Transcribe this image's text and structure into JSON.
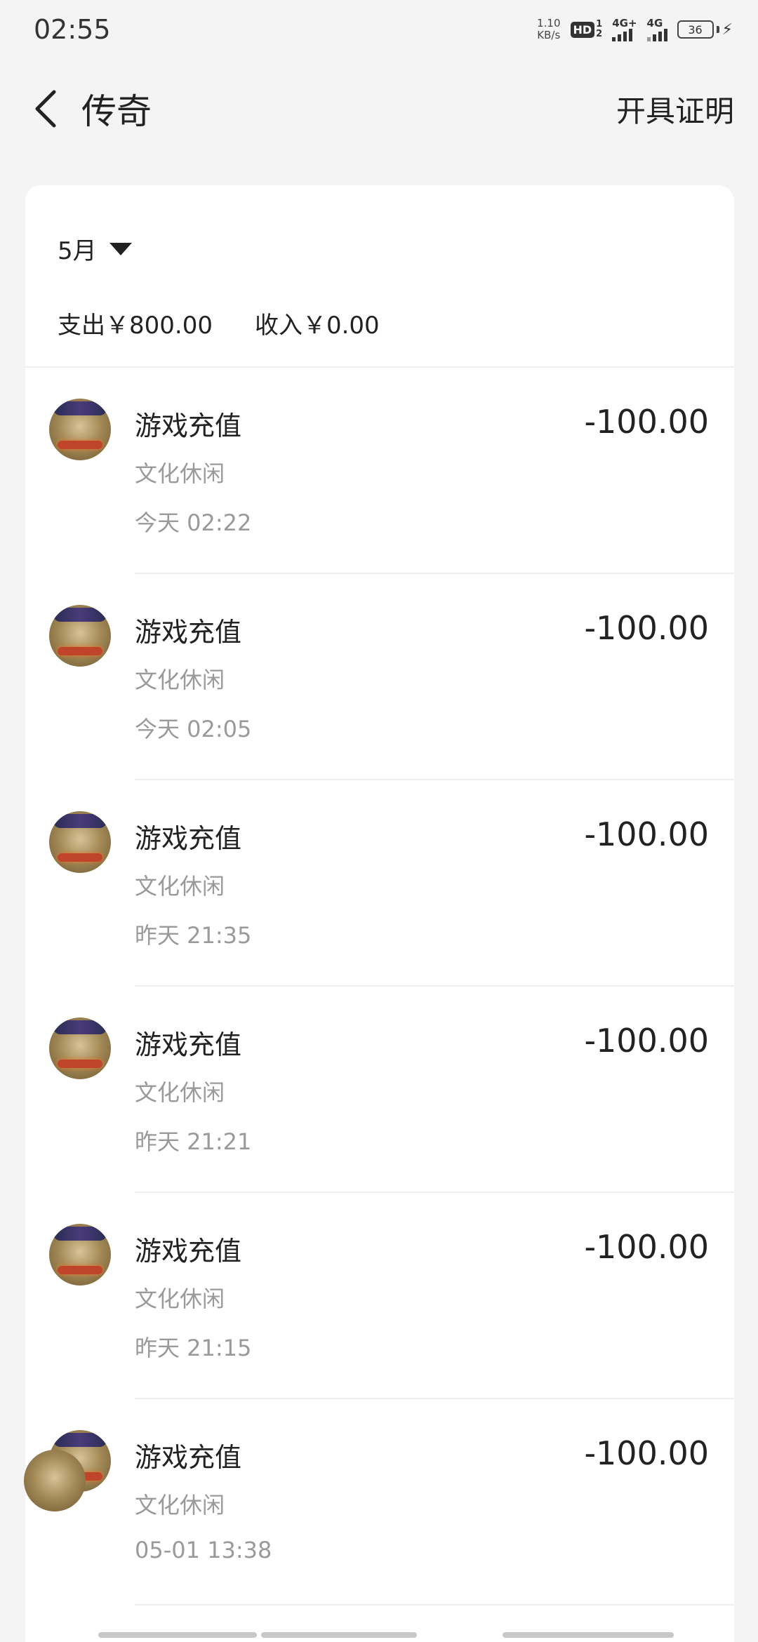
{
  "status_bar": {
    "time": "02:55",
    "net_speed_value": "1.10",
    "net_speed_unit": "KB/s",
    "hd_label": "HD",
    "hd_sub_top": "1",
    "hd_sub_bottom": "2",
    "sim1_label": "4G+",
    "sim2_label": "4G",
    "battery_level": "36"
  },
  "header": {
    "title": "传奇",
    "certificate_label": "开具证明"
  },
  "filter": {
    "month_label": "5月"
  },
  "summary": {
    "expense": "支出￥800.00",
    "income": "收入￥0.00"
  },
  "transactions": [
    {
      "title": "游戏充值",
      "category": "文化休闲",
      "time": "今天 02:22",
      "amount": "-100.00"
    },
    {
      "title": "游戏充值",
      "category": "文化休闲",
      "time": "今天 02:05",
      "amount": "-100.00"
    },
    {
      "title": "游戏充值",
      "category": "文化休闲",
      "time": "昨天 21:35",
      "amount": "-100.00"
    },
    {
      "title": "游戏充值",
      "category": "文化休闲",
      "time": "昨天 21:21",
      "amount": "-100.00"
    },
    {
      "title": "游戏充值",
      "category": "文化休闲",
      "time": "昨天 21:15",
      "amount": "-100.00"
    },
    {
      "title": "游戏充值",
      "category": "文化休闲",
      "time": "05-01 13:38",
      "amount": "-100.00"
    }
  ],
  "icons": {
    "back": "chevron-left-icon",
    "month_dropdown": "caret-down-icon",
    "charging": "lightning-bolt-icon"
  }
}
